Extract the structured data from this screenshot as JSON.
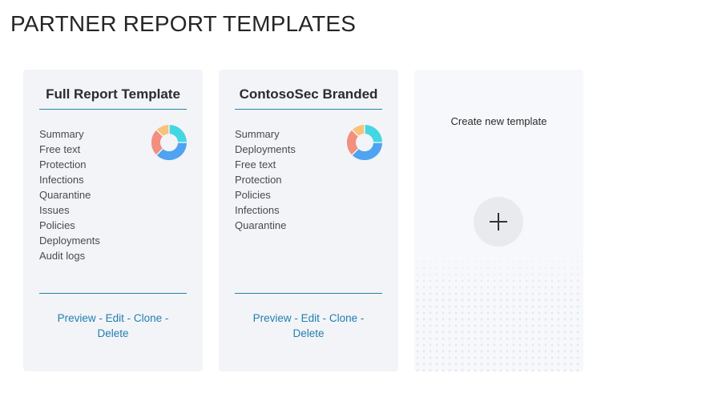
{
  "page": {
    "title": "PARTNER REPORT TEMPLATES"
  },
  "templates": [
    {
      "title": "Full Report Template",
      "sections": [
        "Summary",
        "Free text",
        "Protection",
        "Infections",
        "Quarantine",
        "Issues",
        "Policies",
        "Deployments",
        "Audit logs"
      ],
      "actions": {
        "preview": "Preview",
        "edit": "Edit",
        "clone": "Clone",
        "delete": "Delete",
        "separator": " - "
      }
    },
    {
      "title": "ContosoSec Branded",
      "sections": [
        "Summary",
        "Deployments",
        "Free text",
        "Protection",
        "Policies",
        "Infections",
        "Quarantine"
      ],
      "actions": {
        "preview": "Preview",
        "edit": "Edit",
        "clone": "Clone",
        "delete": "Delete",
        "separator": " - "
      }
    }
  ],
  "create_new": {
    "label": "Create new template",
    "icon": "plus-icon"
  },
  "colors": {
    "accent": "#2386a8",
    "link": "#1f7fb0",
    "donut": [
      "#43d6e3",
      "#4fa3f1",
      "#f28f7e",
      "#f9c27a"
    ]
  }
}
